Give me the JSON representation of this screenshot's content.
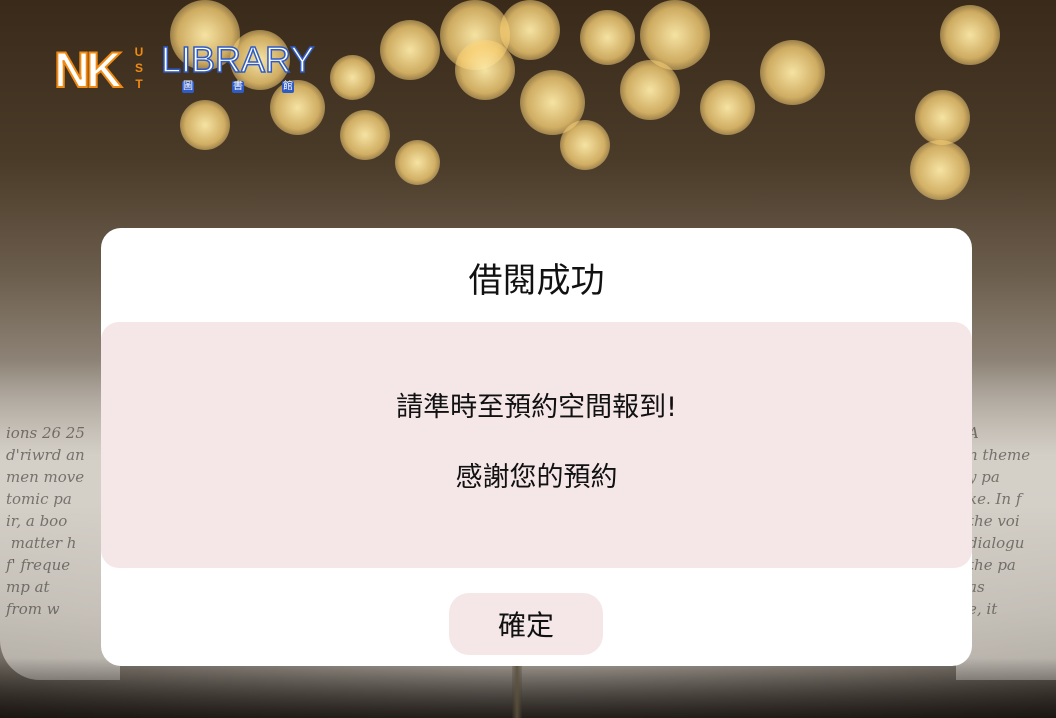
{
  "logo": {
    "nk": "NK",
    "ust": [
      "U",
      "S",
      "T"
    ],
    "library": "LIBRARY",
    "sub": [
      "圖",
      "書",
      "館"
    ]
  },
  "dialog": {
    "title": "借閱成功",
    "message_line1": "請準時至預約空間報到!",
    "message_line2": "感謝您的預約",
    "confirm_label": "確定"
  },
  "background": {
    "book_text_left": "ions 26 25\nd'riwrd an\nmen move\ntomic pa\nir, a boo\n matter h\nf' freque\nmp at\nfrom w",
    "book_text_right": "A\nn theme\ny pa\nke. In f\nthe voi\ndialogu\nthe pa\nas\ne, it"
  },
  "colors": {
    "dialog_background": "#ffffff",
    "panel_background": "#f5e7e8",
    "logo_orange": "#f08a12",
    "logo_blue": "#2f5bc4"
  }
}
